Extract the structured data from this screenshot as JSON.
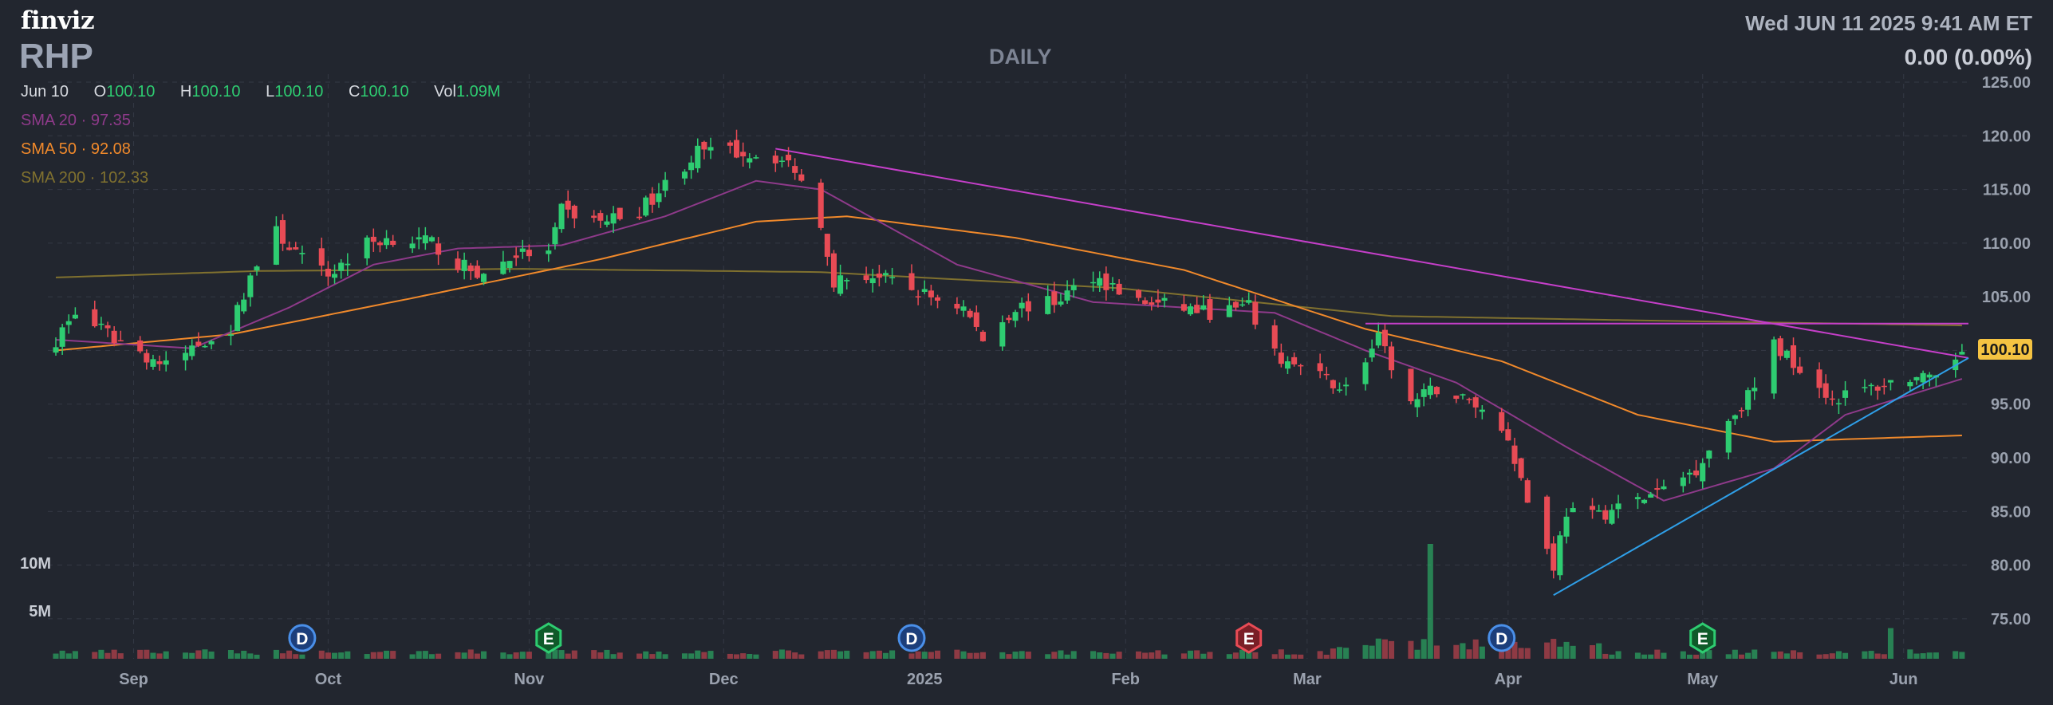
{
  "brand": "finviz",
  "ticker": "RHP",
  "period": "DAILY",
  "datetime": "Wed JUN 11 2025 9:41 AM ET",
  "change": "0.00 (0.00%)",
  "ohlc": {
    "date": "Jun 10",
    "o_label": "O",
    "o": "100.10",
    "h_label": "H",
    "h": "100.10",
    "l_label": "L",
    "l": "100.10",
    "c_label": "C",
    "c": "100.10",
    "vol_label": "Vol",
    "vol": "1.09M"
  },
  "sma": [
    {
      "label": "SMA 20",
      "sep": "·",
      "value": "97.35",
      "color": "#8e3a8a"
    },
    {
      "label": "SMA 50",
      "sep": "·",
      "value": "92.08",
      "color": "#f0892b"
    },
    {
      "label": "SMA 200",
      "sep": "·",
      "value": "102.33",
      "color": "#80712f"
    }
  ],
  "colors": {
    "background": "#22262f",
    "grid": "#343945",
    "up": "#2ecc71",
    "down": "#e84b55",
    "trendline_down": "#c53fc9",
    "trendline_up": "#2f9fe8",
    "resistance": "#c53fc9",
    "price_label_bg": "#f5c342"
  },
  "chart_data": {
    "type": "candlestick",
    "title": "",
    "y_axis": {
      "ticks": [
        "75.00",
        "80.00",
        "85.00",
        "90.00",
        "95.00",
        "100.00",
        "105.00",
        "110.00",
        "115.00",
        "120.00",
        "125.00"
      ],
      "range": [
        73.5,
        125
      ]
    },
    "x_axis": {
      "ticks": [
        "Sep",
        "Oct",
        "Nov",
        "Dec",
        "2025",
        "Feb",
        "Mar",
        "Apr",
        "May",
        "Jun"
      ],
      "start": "2024-08-20",
      "end": "2025-06-11"
    },
    "volume_axis": {
      "ticks": [
        "10M",
        "5M"
      ]
    },
    "current_price_label": "100.10",
    "close_anchors": [
      [
        "2024-08-20",
        101
      ],
      [
        "2024-08-23",
        103.5
      ],
      [
        "2024-08-28",
        101.5
      ],
      [
        "2024-09-03",
        99.5
      ],
      [
        "2024-09-06",
        98.5
      ],
      [
        "2024-09-12",
        101
      ],
      [
        "2024-09-16",
        102
      ],
      [
        "2024-09-19",
        107
      ],
      [
        "2024-09-23",
        111
      ],
      [
        "2024-09-27",
        108.5
      ],
      [
        "2024-10-01",
        107
      ],
      [
        "2024-10-07",
        110
      ],
      [
        "2024-10-11",
        110.5
      ],
      [
        "2024-10-17",
        110
      ],
      [
        "2024-10-21",
        108
      ],
      [
        "2024-10-25",
        107
      ],
      [
        "2024-10-30",
        109
      ],
      [
        "2024-11-04",
        109
      ],
      [
        "2024-11-06",
        113
      ],
      [
        "2024-11-12",
        112
      ],
      [
        "2024-11-18",
        113
      ],
      [
        "2024-11-22",
        115.5
      ],
      [
        "2024-11-27",
        118.5
      ],
      [
        "2024-12-03",
        118.5
      ],
      [
        "2024-12-09",
        118
      ],
      [
        "2024-12-12",
        117
      ],
      [
        "2024-12-16",
        112
      ],
      [
        "2024-12-18",
        106.5
      ],
      [
        "2024-12-24",
        107
      ],
      [
        "2025-01-02",
        105
      ],
      [
        "2025-01-07",
        104
      ],
      [
        "2025-01-10",
        101
      ],
      [
        "2025-01-15",
        104
      ],
      [
        "2025-01-21",
        104.5
      ],
      [
        "2025-01-27",
        107
      ],
      [
        "2025-02-03",
        104.5
      ],
      [
        "2025-02-10",
        104
      ],
      [
        "2025-02-14",
        103.5
      ],
      [
        "2025-02-20",
        104
      ],
      [
        "2025-02-24",
        99.5
      ],
      [
        "2025-03-03",
        97.5
      ],
      [
        "2025-03-07",
        96.5
      ],
      [
        "2025-03-12",
        101
      ],
      [
        "2025-03-17",
        95
      ],
      [
        "2025-03-21",
        96.5
      ],
      [
        "2025-03-27",
        95
      ],
      [
        "2025-04-01",
        92
      ],
      [
        "2025-04-04",
        86
      ],
      [
        "2025-04-08",
        80
      ],
      [
        "2025-04-10",
        85
      ],
      [
        "2025-04-14",
        84.5
      ],
      [
        "2025-04-21",
        86
      ],
      [
        "2025-04-25",
        87
      ],
      [
        "2025-04-30",
        89
      ],
      [
        "2025-05-05",
        93.5
      ],
      [
        "2025-05-09",
        96.5
      ],
      [
        "2025-05-12",
        100.5
      ],
      [
        "2025-05-16",
        98.5
      ],
      [
        "2025-05-21",
        95.5
      ],
      [
        "2025-05-27",
        96.5
      ],
      [
        "2025-06-02",
        97.5
      ],
      [
        "2025-06-06",
        97
      ],
      [
        "2025-06-10",
        100.1
      ]
    ],
    "sma20_anchors": [
      [
        "2024-08-20",
        101
      ],
      [
        "2024-09-10",
        100.2
      ],
      [
        "2024-09-25",
        104
      ],
      [
        "2024-10-08",
        108
      ],
      [
        "2024-10-21",
        109.5
      ],
      [
        "2024-11-06",
        109.8
      ],
      [
        "2024-11-22",
        112.5
      ],
      [
        "2024-12-06",
        115.8
      ],
      [
        "2024-12-16",
        115
      ],
      [
        "2025-01-06",
        108
      ],
      [
        "2025-01-27",
        104.5
      ],
      [
        "2025-02-24",
        103.5
      ],
      [
        "2025-03-10",
        100
      ],
      [
        "2025-03-24",
        97
      ],
      [
        "2025-04-10",
        91
      ],
      [
        "2025-04-25",
        86
      ],
      [
        "2025-05-12",
        89
      ],
      [
        "2025-05-23",
        94
      ],
      [
        "2025-06-10",
        97.35
      ]
    ],
    "sma50_anchors": [
      [
        "2024-08-20",
        100
      ],
      [
        "2024-09-16",
        101.5
      ],
      [
        "2024-10-15",
        105
      ],
      [
        "2024-11-12",
        108.5
      ],
      [
        "2024-12-06",
        112
      ],
      [
        "2024-12-20",
        112.5
      ],
      [
        "2025-01-15",
        110.5
      ],
      [
        "2025-02-10",
        107.5
      ],
      [
        "2025-03-10",
        102
      ],
      [
        "2025-03-31",
        99
      ],
      [
        "2025-04-21",
        94
      ],
      [
        "2025-05-12",
        91.5
      ],
      [
        "2025-06-10",
        92.08
      ]
    ],
    "sma200_anchors": [
      [
        "2024-08-20",
        106.8
      ],
      [
        "2024-09-20",
        107.4
      ],
      [
        "2024-10-31",
        107.6
      ],
      [
        "2024-12-16",
        107.3
      ],
      [
        "2025-01-31",
        105.8
      ],
      [
        "2025-03-14",
        103.2
      ],
      [
        "2025-04-21",
        102.8
      ],
      [
        "2025-06-10",
        102.33
      ]
    ],
    "trendlines": [
      {
        "name": "descending resistance",
        "from": [
          "2024-12-09",
          118.8
        ],
        "to": [
          "2025-06-11",
          99.3
        ],
        "color": "#c53fc9"
      },
      {
        "name": "horizontal resistance",
        "from": [
          "2025-03-10",
          102.5
        ],
        "to": [
          "2025-06-11",
          102.5
        ],
        "color": "#c53fc9"
      },
      {
        "name": "ascending support",
        "from": [
          "2025-04-08",
          77.2
        ],
        "to": [
          "2025-06-11",
          99.3
        ],
        "color": "#2f9fe8"
      }
    ],
    "event_markers": [
      {
        "letter": "D",
        "date": "2024-09-27",
        "kind": "dividend"
      },
      {
        "letter": "E",
        "date": "2024-11-04",
        "kind": "earnings-beat"
      },
      {
        "letter": "D",
        "date": "2024-12-30",
        "kind": "dividend"
      },
      {
        "letter": "E",
        "date": "2025-02-20",
        "kind": "earnings-miss"
      },
      {
        "letter": "D",
        "date": "2025-03-31",
        "kind": "dividend"
      },
      {
        "letter": "E",
        "date": "2025-05-01",
        "kind": "earnings-beat"
      }
    ],
    "volume_spikes": [
      {
        "date": "2025-03-20",
        "value": 12.0
      },
      {
        "date": "2025-05-30",
        "value": 3.2
      }
    ],
    "volume_base_m": 0.7
  }
}
